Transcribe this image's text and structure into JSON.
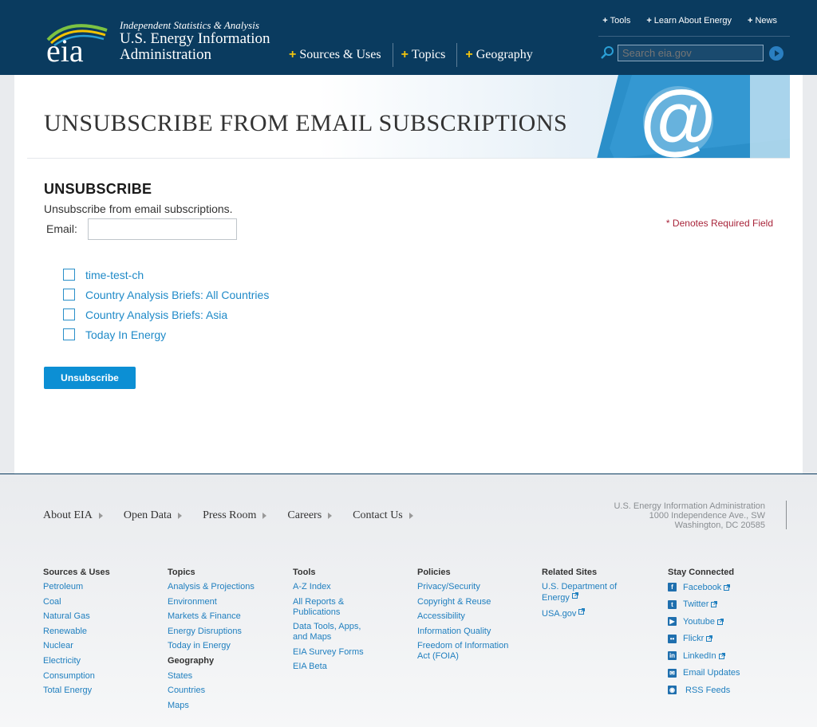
{
  "header": {
    "tagline": "Independent Statistics & Analysis",
    "org_line1": "U.S. Energy Information",
    "org_line2": "Administration",
    "logo_text": "eia",
    "main_nav": [
      {
        "label": "Sources & Uses"
      },
      {
        "label": "Topics"
      },
      {
        "label": "Geography"
      }
    ],
    "util_nav": [
      {
        "label": "Tools"
      },
      {
        "label": "Learn About Energy"
      },
      {
        "label": "News"
      }
    ],
    "search_placeholder": "Search eia.gov",
    "plus": "+"
  },
  "banner": {
    "title": "UNSUBSCRIBE FROM EMAIL SUBSCRIPTIONS",
    "art_text": "@"
  },
  "form": {
    "section_title": "UNSUBSCRIBE",
    "description": "Unsubscribe from email subscriptions.",
    "email_label": "Email:",
    "email_value": "",
    "required_note": "* Denotes Required Field",
    "subscriptions": [
      {
        "label": "time-test-ch",
        "checked": false
      },
      {
        "label": "Country Analysis Briefs: All Countries",
        "checked": false
      },
      {
        "label": "Country Analysis Briefs: Asia",
        "checked": false
      },
      {
        "label": "Today In Energy",
        "checked": false
      }
    ],
    "submit_label": "Unsubscribe"
  },
  "footer": {
    "nav": [
      {
        "label": "About EIA"
      },
      {
        "label": "Open Data"
      },
      {
        "label": "Press Room"
      },
      {
        "label": "Careers"
      },
      {
        "label": "Contact Us"
      }
    ],
    "address": {
      "line1": "U.S. Energy Information Administration",
      "line2": "1000 Independence Ave., SW",
      "line3": "Washington, DC 20585"
    },
    "columns": {
      "sources": {
        "title": "Sources & Uses",
        "links": [
          "Petroleum",
          "Coal",
          "Natural Gas",
          "Renewable",
          "Nuclear",
          "Electricity",
          "Consumption",
          "Total Energy"
        ]
      },
      "topics": {
        "title": "Topics",
        "links": [
          "Analysis & Projections",
          "Environment",
          "Markets & Finance",
          "Energy Disruptions",
          "Today in Energy"
        ],
        "subtitle": "Geography",
        "sublinks": [
          "States",
          "Countries",
          "Maps"
        ]
      },
      "tools": {
        "title": "Tools",
        "links": [
          "A-Z Index",
          "All Reports & Publications",
          "Data Tools, Apps, and Maps",
          "EIA Survey Forms",
          "EIA Beta"
        ]
      },
      "policies": {
        "title": "Policies",
        "links": [
          "Privacy/Security",
          "Copyright & Reuse",
          "Accessibility",
          "Information Quality",
          "Freedom of Information Act (FOIA)"
        ]
      },
      "related": {
        "title": "Related Sites",
        "links": [
          "U.S. Department of Energy",
          "USA.gov"
        ]
      },
      "connected": {
        "title": "Stay Connected",
        "links": [
          {
            "label": "Facebook",
            "icon": "facebook-icon",
            "glyph": "f"
          },
          {
            "label": "Twitter",
            "icon": "twitter-icon",
            "glyph": "t"
          },
          {
            "label": "Youtube",
            "icon": "youtube-icon",
            "glyph": "▶"
          },
          {
            "label": "Flickr",
            "icon": "flickr-icon",
            "glyph": "••"
          },
          {
            "label": "LinkedIn",
            "icon": "linkedin-icon",
            "glyph": "in"
          },
          {
            "label": "Email Updates",
            "icon": "email-icon",
            "glyph": "✉"
          },
          {
            "label": "RSS Feeds",
            "icon": "rss-icon",
            "glyph": "◉"
          }
        ]
      }
    }
  },
  "colors": {
    "header_bg": "#0a3b5f",
    "accent_yellow": "#f1c40f",
    "link_blue": "#1f8ac8",
    "button_blue": "#0c8fd4",
    "required_red": "#a8243a"
  }
}
